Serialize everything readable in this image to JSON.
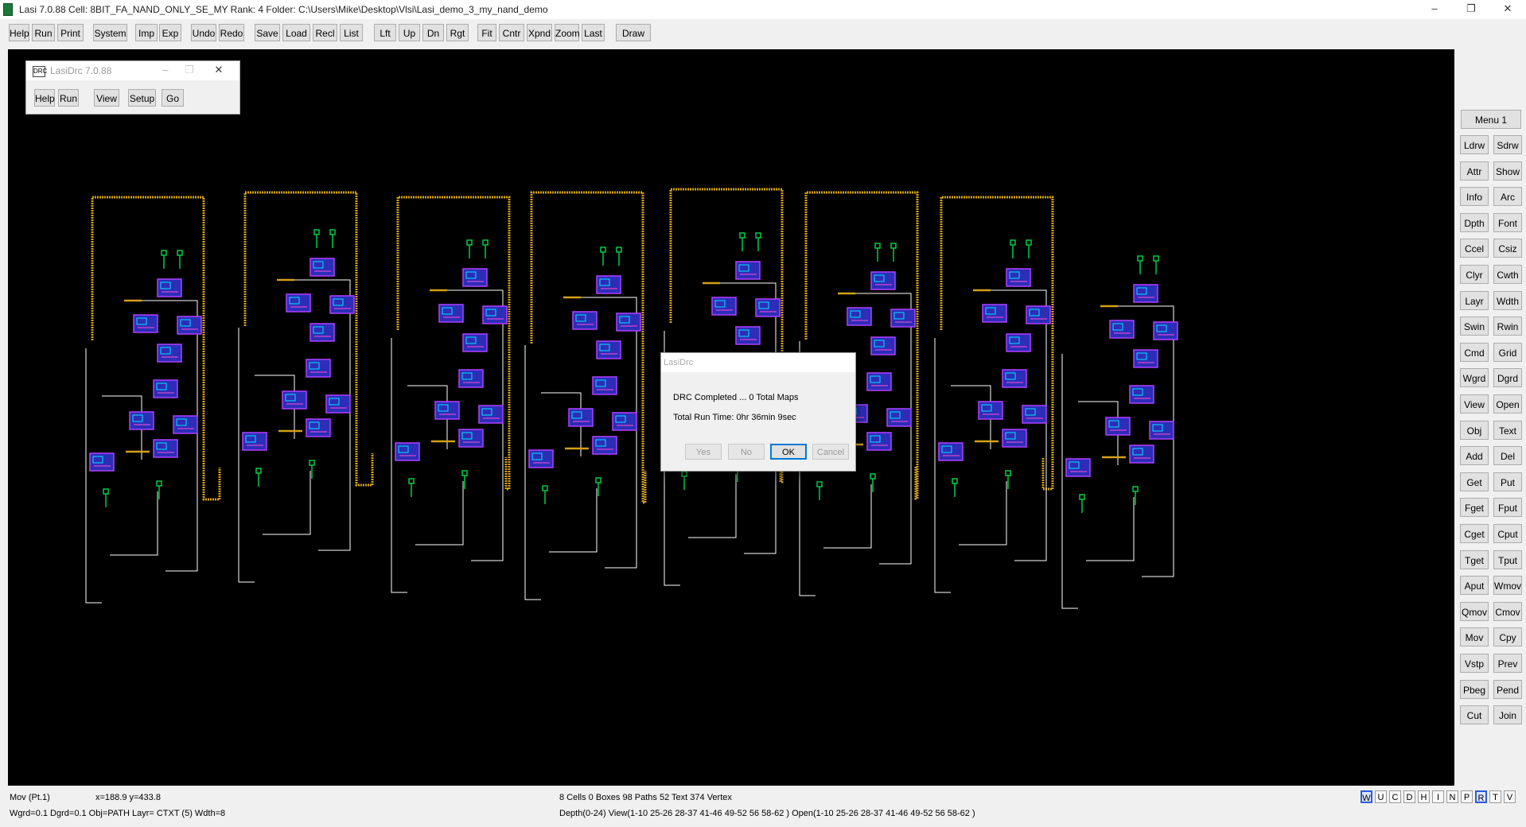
{
  "window": {
    "title": "Lasi 7.0.88    Cell: 8BIT_FA_NAND_ONLY_SE_MY    Rank: 4    Folder: C:\\Users\\Mike\\Desktop\\Vlsi\\Lasi_demo_3_my_nand_demo",
    "minimize": "–",
    "restore": "❐",
    "close": "✕"
  },
  "toolbar": [
    "Help",
    "Run",
    "Print",
    "System",
    "Imp",
    "Exp",
    "Undo",
    "Redo",
    "Save",
    "Load",
    "Recl",
    "List",
    "Lft",
    "Up",
    "Dn",
    "Rgt",
    "Fit",
    "Cntr",
    "Xpnd",
    "Zoom",
    "Last",
    "Draw"
  ],
  "right_menu": {
    "title": "Menu 1",
    "buttons": [
      "Ldrw",
      "Sdrw",
      "Attr",
      "Show",
      "Info",
      "Arc",
      "Dpth",
      "Font",
      "Ccel",
      "Csiz",
      "Clyr",
      "Cwth",
      "Layr",
      "Wdth",
      "Swin",
      "Rwin",
      "Cmd",
      "Grid",
      "Wgrd",
      "Dgrd",
      "View",
      "Open",
      "Obj",
      "Text",
      "Add",
      "Del",
      "Get",
      "Put",
      "Fget",
      "Fput",
      "Cget",
      "Cput",
      "Tget",
      "Tput",
      "Aput",
      "Wmov",
      "Qmov",
      "Cmov",
      "Mov",
      "Cpy",
      "Vstp",
      "Prev",
      "Pbeg",
      "Pend",
      "Cut",
      "Join"
    ]
  },
  "lasidrc": {
    "title": "LasiDrc 7.0.88",
    "icon_text": "DRC",
    "buttons": [
      "Help",
      "Run",
      "View",
      "Setup",
      "Go"
    ]
  },
  "dialog": {
    "title": "LasiDrc",
    "line1": "DRC Completed ...  0 Total Maps",
    "line2": "Total Run Time:  0hr 36min 9sec",
    "yes": "Yes",
    "no": "No",
    "ok": "OK",
    "cancel": "Cancel"
  },
  "status": {
    "mode": "Mov  (Pt.1)",
    "coords": "x=188.9  y=433.8",
    "stats": "8 Cells  0 Boxes  98 Paths  52 Text  374 Vertex",
    "settings": "Wgrd=0.1  Dgrd=0.1  Obj=PATH  Layr= CTXT (5)  Wdth=8",
    "depth": "Depth(0-24)  View(1-10 25-26 28-37 41-46 49-52 56 58-62 )  Open(1-10 25-26 28-37 41-46 49-52 56 58-62 )"
  },
  "toggles": [
    "W",
    "U",
    "C",
    "D",
    "H",
    "I",
    "N",
    "P",
    "R",
    "T",
    "V"
  ],
  "toggles_active": [
    "W",
    "R"
  ],
  "colors": {
    "canvas": "#000000",
    "path": "#d4a017",
    "wire": "#ffffff",
    "pin": "#00cc44",
    "cell_fill": "#2d2db8",
    "cell_outline": "#b040ff"
  }
}
